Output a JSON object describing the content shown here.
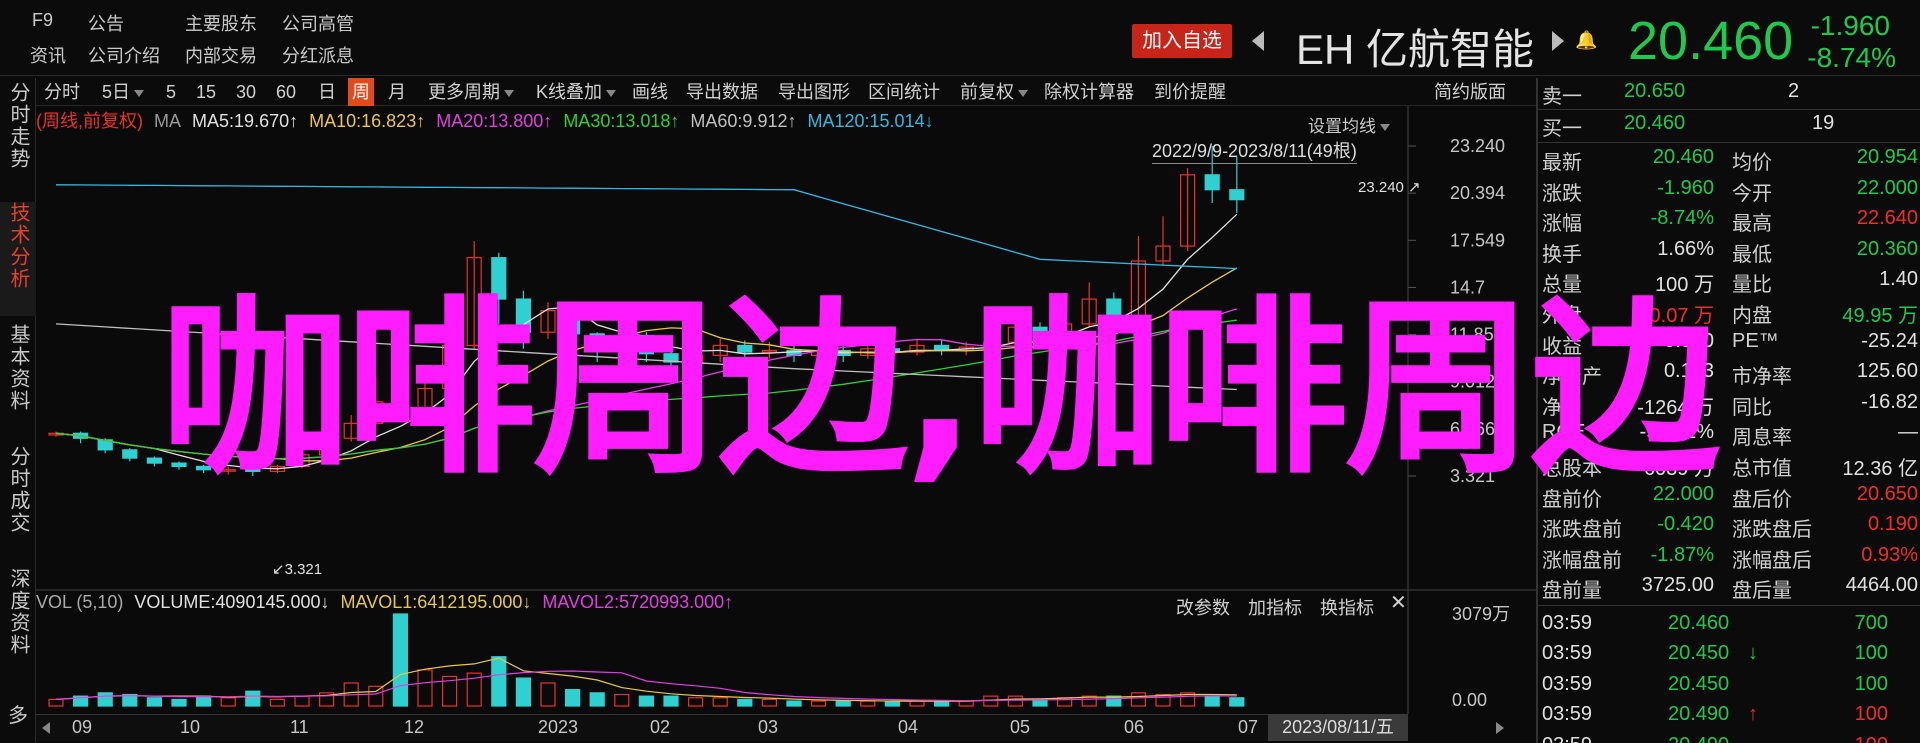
{
  "topbar": {
    "links": [
      {
        "label": "F9",
        "x": "l1"
      },
      {
        "label": "公告"
      },
      {
        "label": "主要股东"
      },
      {
        "label": "公司高管"
      },
      {
        "label": "资讯"
      },
      {
        "label": "公司介绍"
      },
      {
        "label": "内部交易"
      },
      {
        "label": "分红派息"
      }
    ],
    "add_watchlist": "加入自选",
    "stock_code": "EH",
    "stock_name": "亿航智能",
    "price": "20.460",
    "change": "-1.960",
    "change_pct": "-8.74%"
  },
  "left_tabs": [
    "分时走势",
    "技术分析",
    "基本资料",
    "分时成交",
    "深度资料",
    "多"
  ],
  "toolbar": {
    "items": [
      "分时",
      "5日",
      "5",
      "15",
      "30",
      "60",
      "日",
      "周",
      "月",
      "更多周期",
      "K线叠加",
      "画线",
      "导出数据",
      "导出图形",
      "区间统计",
      "前复权",
      "除权计算器",
      "到价提醒"
    ],
    "selected": "周",
    "simple_layout": "简约版面"
  },
  "ma_legend": {
    "mode": "(周线,前复权)",
    "ma": "MA",
    "ma5": "MA5:19.670↑",
    "ma10": "MA10:16.823↑",
    "ma20": "MA20:13.800↑",
    "ma30": "MA30:13.018↑",
    "ma60": "MA60:9.912↑",
    "ma120": "MA120:15.014↓"
  },
  "chart": {
    "avg_setting": "设置均线",
    "date_range": "2022/9/9-2023/8/11(49根)",
    "y_ticks": [
      "23.240",
      "20.394",
      "17.549",
      "14.7",
      "11.858",
      "9.012",
      "6.166",
      "3.321"
    ],
    "high_label": "23.240",
    "low_label": "3.321",
    "colors": {
      "up": "#e8332a",
      "down": "#2fd0d0",
      "ma5": "#e0e0e0",
      "ma10": "#e8c84a",
      "ma20": "#e040e0",
      "ma30": "#30d030",
      "ma60": "#c0c0c0",
      "ma120": "#34b8e0"
    }
  },
  "volume": {
    "label": "VOL (5,10)",
    "volume": "VOLUME:4090145.000↓",
    "mavol1": "MAVOL1:6412195.000↓",
    "mavol2": "MAVOL2:5720993.000↑",
    "tools": [
      "改参数",
      "加指标",
      "换指标"
    ],
    "y_ticks": [
      "3079万",
      "0.00"
    ]
  },
  "x_axis": {
    "labels": [
      "09",
      "10",
      "11",
      "12",
      "2023",
      "02",
      "03",
      "04",
      "05",
      "06",
      "07"
    ],
    "cursor_date": "2023/08/11/五"
  },
  "quote": {
    "ask1": {
      "label": "卖一",
      "price": "20.650",
      "vol": "2"
    },
    "bid1": {
      "label": "买一",
      "price": "20.460",
      "vol": "19"
    },
    "rows": [
      {
        "l1": "最新",
        "v1": "20.460",
        "c1": "g",
        "l2": "均价",
        "v2": "20.954",
        "c2": "g"
      },
      {
        "l1": "涨跌",
        "v1": "-1.960",
        "c1": "g",
        "l2": "今开",
        "v2": "22.000",
        "c2": "g"
      },
      {
        "l1": "涨幅",
        "v1": "-8.74%",
        "c1": "g",
        "l2": "最高",
        "v2": "22.640",
        "c2": "r"
      },
      {
        "l1": "换手",
        "v1": "1.66%",
        "c1": "w",
        "l2": "最低",
        "v2": "20.360",
        "c2": "g"
      },
      {
        "l1": "总量",
        "v1": "100 万",
        "c1": "w",
        "l2": "量比",
        "v2": "1.40",
        "c2": "w"
      },
      {
        "l1": "外盘",
        "v1": "50.07 万",
        "c1": "r",
        "l2": "内盘",
        "v2": "49.95 万",
        "c2": "g"
      },
      {
        "l1": "收益",
        "v1": "-0.810",
        "c1": "w",
        "l2": "PE™",
        "v2": "-25.24",
        "c2": "w"
      },
      {
        "l1": "净资产",
        "v1": "0.163",
        "c1": "w",
        "l2": "市净率",
        "v2": "125.60",
        "c2": "w"
      },
      {
        "l1": "净利",
        "v1": "-1264 万",
        "c1": "w",
        "l2": "同比",
        "v2": "-16.82",
        "c2": "w"
      },
      {
        "l1": "ROE",
        "v1": "-90.51%",
        "c1": "w",
        "l2": "周息率",
        "v2": "—",
        "c2": "w"
      },
      {
        "l1": "总股本",
        "v1": "6039 万",
        "c1": "w",
        "l2": "总市值",
        "v2": "12.36 亿",
        "c2": "w"
      },
      {
        "l1": "盘前价",
        "v1": "22.000",
        "c1": "g",
        "l2": "盘后价",
        "v2": "20.650",
        "c2": "r"
      },
      {
        "l1": "涨跌盘前",
        "v1": "-0.420",
        "c1": "g",
        "l2": "涨跌盘后",
        "v2": "0.190",
        "c2": "r"
      },
      {
        "l1": "涨幅盘前",
        "v1": "-1.87%",
        "c1": "g",
        "l2": "涨幅盘后",
        "v2": "0.93%",
        "c2": "r"
      },
      {
        "l1": "盘前量",
        "v1": "3725.00",
        "c1": "w",
        "l2": "盘后量",
        "v2": "4464.00",
        "c2": "w"
      }
    ],
    "ticks": [
      {
        "time": "03:59",
        "price": "20.460",
        "arrow": "",
        "vol": "700",
        "vc": "g"
      },
      {
        "time": "03:59",
        "price": "20.450",
        "arrow": "↓",
        "vol": "100",
        "vc": "g"
      },
      {
        "time": "03:59",
        "price": "20.450",
        "arrow": "",
        "vol": "100",
        "vc": "g"
      },
      {
        "time": "03:59",
        "price": "20.490",
        "arrow": "↑",
        "vol": "100",
        "vc": "r"
      },
      {
        "time": "03:59",
        "price": "20.490",
        "arrow": "",
        "vol": "100",
        "vc": "r"
      }
    ]
  },
  "overlay_text": "咖啡周边,咖啡周边"
}
